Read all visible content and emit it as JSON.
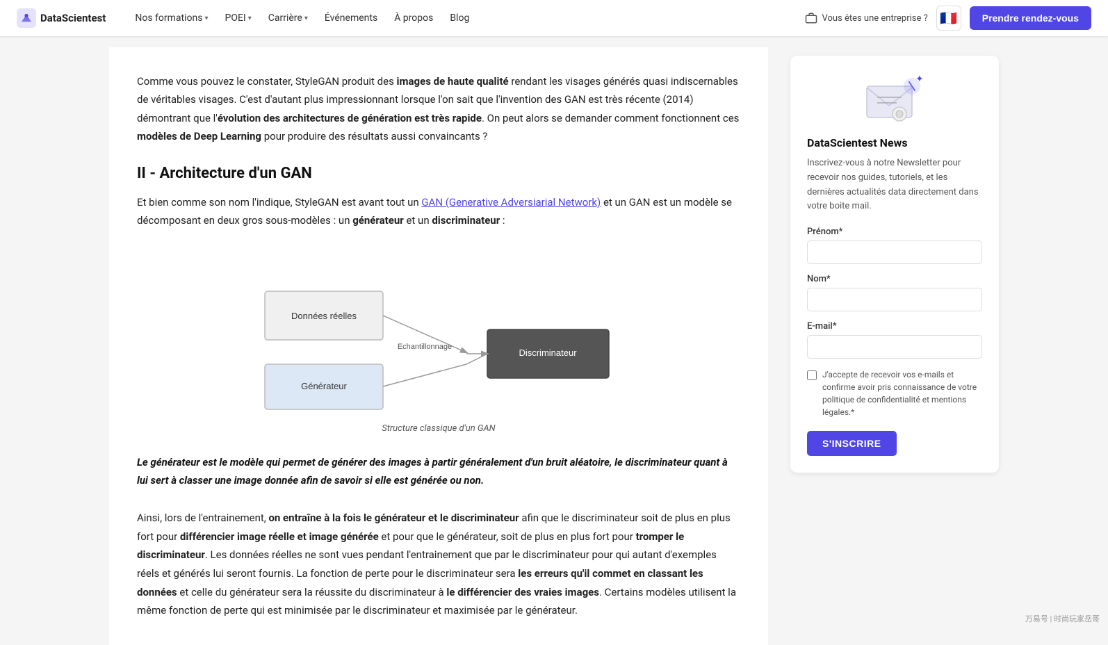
{
  "nav": {
    "logo_text": "DataScientest",
    "links": [
      {
        "label": "Nos formations",
        "has_dropdown": true
      },
      {
        "label": "POEI",
        "has_dropdown": true
      },
      {
        "label": "Carrière",
        "has_dropdown": true
      },
      {
        "label": "Événements",
        "has_dropdown": false
      },
      {
        "label": "À propos",
        "has_dropdown": false
      },
      {
        "label": "Blog",
        "has_dropdown": false
      }
    ],
    "enterprise_label": "Vous êtes une entreprise ?",
    "flag_emoji": "🇫🇷",
    "cta_label": "Prendre rendez-vous"
  },
  "main": {
    "intro": {
      "part1": "Comme vous pouvez le constater, StyleGAN produit des ",
      "bold1": "images de haute qualité",
      "part2": " rendant les visages générés quasi indiscernables de véritables visages. C'est d'autant plus impressionnant lorsque l'on sait que l'invention des GAN est très récente (2014) démontrant que l'",
      "bold2": "évolution des architectures de génération est très rapide",
      "part3": ". On peut alors se demander comment fonctionnent ces ",
      "bold3": "modèles de Deep Learning",
      "part4": " pour produire des résultats aussi convaincants ?"
    },
    "section_title": "II - Architecture d'un GAN",
    "section_intro_part1": "Et bien comme son nom l'indique, StyleGAN est avant tout un ",
    "gan_link_text": "GAN (Generative Adversiarial Network)",
    "section_intro_part2": " et un GAN est un modèle se décomposant en deux gros sous-modèles : un ",
    "bold_generateur": "générateur",
    "section_intro_part3": " et un ",
    "bold_discriminateur": "discriminateur",
    "section_intro_part4": " :",
    "diagram_caption": "Structure classique d'un GAN",
    "diagram": {
      "box_donnees": "Données réelles",
      "box_generateur": "Générateur",
      "box_discriminateur": "Discriminateur",
      "label_echantillonnage": "Echantillonnage"
    },
    "highlight": "Le générateur est le modèle qui permet de générer des images à partir généralement d'un bruit aléatoire, le discriminateur quant à lui sert à classer une image donnée afin de savoir si elle est générée ou non.",
    "bottom_text_part1": "Ainsi, lors de l'entrainement, ",
    "bottom_bold1": "on entraîne à la fois le générateur et le discriminateur",
    "bottom_text_part2": " afin que le discriminateur soit de plus en plus fort pour ",
    "bottom_bold2": "différencier image réelle et image générée",
    "bottom_text_part3": " et pour que le générateur, soit de plus en plus fort pour ",
    "bottom_bold3": "tromper le discriminateur",
    "bottom_text_part4": ". Les données réelles ne sont vues pendant l'entrainement que par le discriminateur pour qui autant d'exemples réels et générés lui seront fournis. La fonction de perte pour le discriminateur sera ",
    "bottom_bold4": "les erreurs qu'il commet en classant les données",
    "bottom_text_part5": " et celle du générateur sera la réussite du discriminateur à ",
    "bottom_bold5": "le différencier des vraies images",
    "bottom_text_part6": ". Certains modèles utilisent la même fonction de perte qui est minimisée par le discriminateur et maximisée par le générateur."
  },
  "sidebar": {
    "newsletter": {
      "title": "DataScientest News",
      "description": "Inscrivez-vous à notre Newsletter pour recevoir nos guides, tutoriels, et les dernières actualités data directement dans votre boite mail.",
      "prenom_label": "Prénom*",
      "prenom_placeholder": "",
      "nom_label": "Nom*",
      "nom_placeholder": "",
      "email_label": "E-mail*",
      "email_placeholder": "",
      "checkbox_label": "J'accepte de recevoir vos e-mails et confirme avoir pris connaissance de votre politique de confidentialité et mentions légales.*",
      "subscribe_btn": "S'INSCRIRE"
    }
  },
  "watermark": "万易号 | 时尚玩家岳哥"
}
